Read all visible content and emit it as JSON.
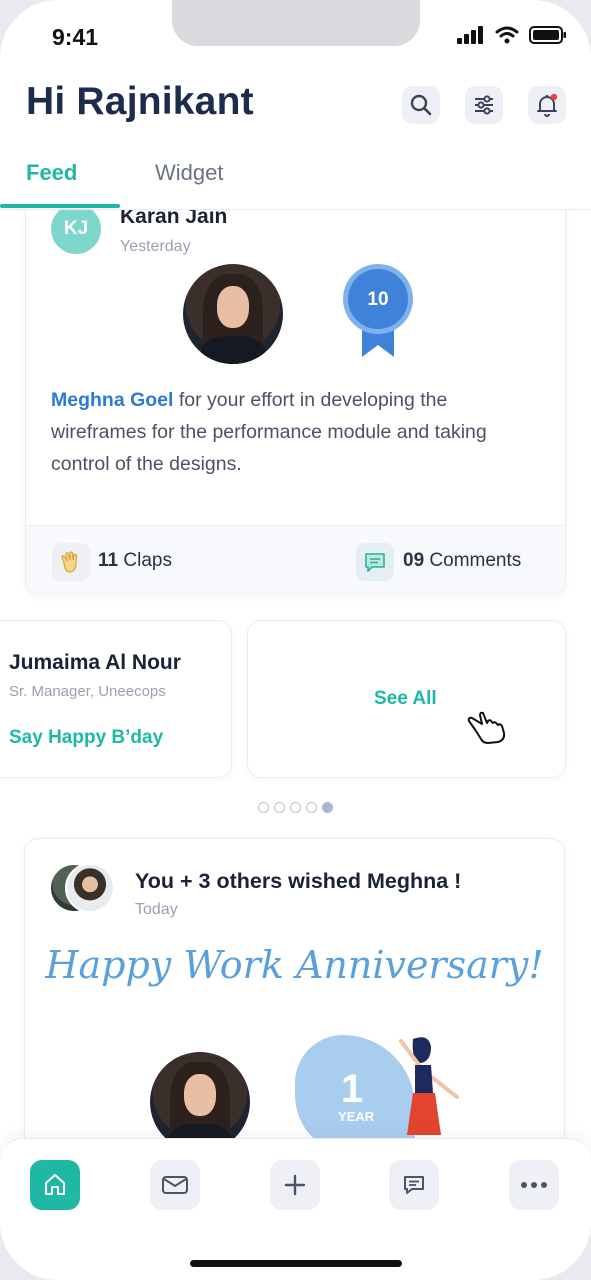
{
  "status_bar": {
    "time": "9:41"
  },
  "header": {
    "greeting": "Hi Rajnikant"
  },
  "tabs": [
    {
      "label": "Feed",
      "active": true
    },
    {
      "label": "Widget",
      "active": false
    }
  ],
  "post": {
    "author_initials": "KJ",
    "author_name": "Karan Jain",
    "posted": "Yesterday",
    "badge_value": "10",
    "mention": "Meghna Goel",
    "text": " for your effort in developing the wireframes for the performance module and taking control of the designs.",
    "claps_count": "11",
    "claps_label": "Claps",
    "comments_count": "09",
    "comments_label": "Comments"
  },
  "birthday_card": {
    "name": "Jumaima Al Nour",
    "role": "Sr. Manager, Uneecops",
    "action": "Say Happy B’day"
  },
  "see_all": {
    "label": "See All"
  },
  "carousel": {
    "dots": 5,
    "active_index": 4
  },
  "anniversary_post": {
    "title": "You + 3 others wished Meghna !",
    "posted": "Today",
    "headline": "Happy Work Anniversary!",
    "years": "1",
    "years_label": "YEAR"
  },
  "colors": {
    "accent": "#1fb8a4",
    "heading": "#1e2c4c",
    "link": "#2a7ad6",
    "badge": "#3f82d9",
    "anniversary": "#5aa0dc"
  },
  "bottom_nav": [
    {
      "icon": "home-icon",
      "active": true
    },
    {
      "icon": "mail-icon",
      "active": false
    },
    {
      "icon": "plus-icon",
      "active": false
    },
    {
      "icon": "chat-icon",
      "active": false
    },
    {
      "icon": "more-icon",
      "active": false
    }
  ]
}
